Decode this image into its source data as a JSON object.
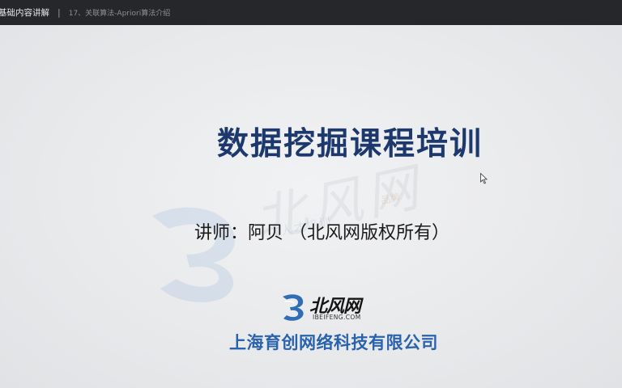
{
  "topbar": {
    "course_title": "基础内容讲解",
    "separator": "|",
    "lesson_title": "17、关联算法-Apriori算法介绍"
  },
  "slide": {
    "title": "数据挖掘课程培训",
    "lecturer": "讲师：阿贝  （北风网版权所有）",
    "logo_cn": "北风网",
    "logo_en": "IBEIFENG.COM",
    "company": "上海育创网络科技有限公司"
  },
  "colors": {
    "title": "#1c386c",
    "company": "#2a63ad",
    "logo_blue": "#2f6db5",
    "topbar": "#26272a"
  }
}
